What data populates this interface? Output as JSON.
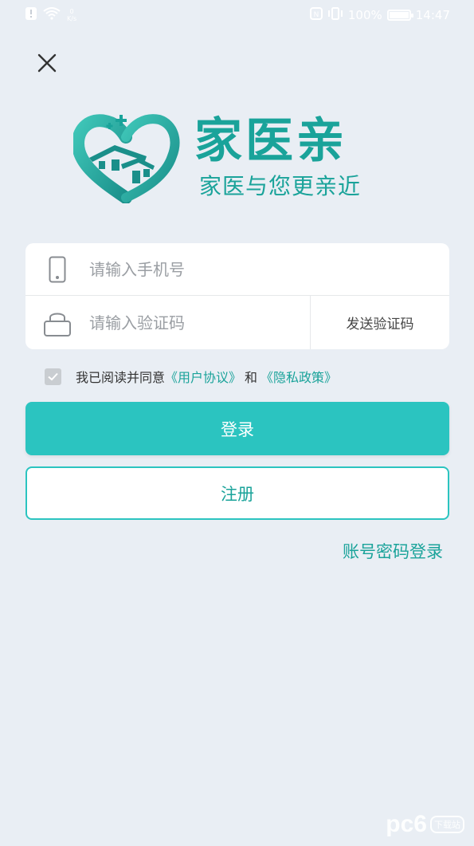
{
  "status_bar": {
    "net_speed_value": "0",
    "net_speed_unit": "K/s",
    "battery_percent": "100%",
    "battery_level": 1.0,
    "time": "14:47"
  },
  "logo": {
    "title": "家医亲",
    "slogan": "家医与您更亲近"
  },
  "form": {
    "phone_placeholder": "请输入手机号",
    "phone_value": "",
    "code_placeholder": "请输入验证码",
    "code_value": "",
    "send_code_label": "发送验证码"
  },
  "agreement": {
    "checked": true,
    "prefix": "我已阅读并同意",
    "user_agreement": "《用户协议》",
    "and": "和",
    "privacy_policy": "《隐私政策》"
  },
  "actions": {
    "login_label": "登录",
    "register_label": "注册",
    "password_login_label": "账号密码登录"
  },
  "watermark": {
    "text": "pc6",
    "tag": "下载站"
  },
  "colors": {
    "accent": "#2bc4c0",
    "brand": "#1aa39a",
    "background": "#e9eef4"
  },
  "icons": [
    "notification-icon",
    "wifi-icon",
    "nfc-icon",
    "vibrate-icon",
    "signal-icon",
    "battery-icon",
    "close-icon",
    "phone-icon",
    "lock-icon",
    "check-icon"
  ]
}
